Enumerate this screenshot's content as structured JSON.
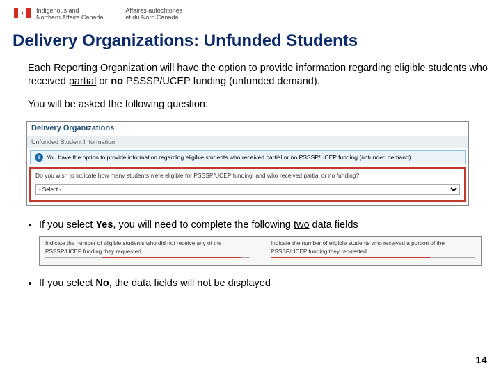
{
  "header": {
    "dept_en_line1": "Indigenous and",
    "dept_en_line2": "Northern Affairs Canada",
    "dept_fr_line1": "Affaires autochtones",
    "dept_fr_line2": "et du Nord Canada"
  },
  "title": "Delivery Organizations:  Unfunded Students",
  "para1_a": "Each Reporting Organization will have the option to provide information regarding eligible students who received ",
  "para1_partial": "partial",
  "para1_b": " or ",
  "para1_no": "no",
  "para1_c": " PSSSP/UCEP funding (unfunded demand).",
  "para2": "You will be asked the following question:",
  "shot1": {
    "panel_title": "Delivery Organizations",
    "sub_title": "Unfunded Student Information",
    "info_text": "You have the option to provide information regarding eligible students who received partial or no PSSSP/UCEP funding (unfunded demand).",
    "question": "Do you wish to indicate how many students were eligible for PSSSP/UCEP funding, and who received partial or no funding?",
    "select_label": "- Select -"
  },
  "bullet_yes_a": "If you select ",
  "bullet_yes_word": "Yes",
  "bullet_yes_b": ", you will need to complete the following ",
  "bullet_yes_two": "two",
  "bullet_yes_c": " data fields",
  "shot2": {
    "field1_a": "Indicate the number of eligible students who did not receive any of the",
    "field1_b": "PSSSP/UCEP funding they requested.",
    "field2_a": "Indicate the number of eligible students who received a portion of the",
    "field2_b": "PSSSP/UCEP funding they requested."
  },
  "bullet_no_a": "If you select ",
  "bullet_no_word": "No",
  "bullet_no_b": ", the data fields will not be displayed",
  "page_number": "14"
}
